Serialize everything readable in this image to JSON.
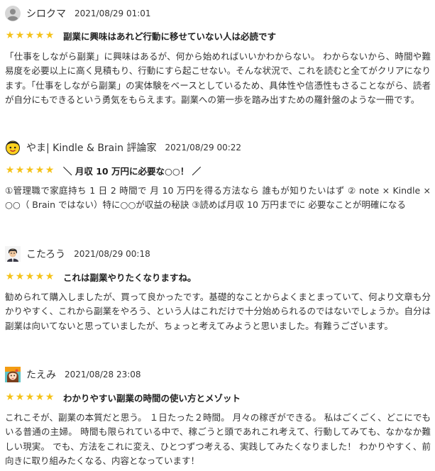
{
  "colors": {
    "star": "#f5c218",
    "text": "#333333"
  },
  "reviews": [
    {
      "name": "シロクマ",
      "date": "2021/08/29 01:01",
      "avatar_icon": "default-user-icon",
      "rating": "★★★★★",
      "stars_value": 5,
      "title": "副業に興味はあれど行動に移せていない人は必読です",
      "body": "「仕事をしながら副業」に興味はあるが、何から始めればいいかわからない。 わからないから、時間や難易度を必要以上に高く見積もり、行動にすら起こせない。そんな状況で、これを読むと全てがクリアになります。「仕事をしながら副業」の実体験をベースとしているため、具体性や信憑性もさることながら、読者が自分にもできるという勇気をもらえます。副業への第一歩を踏み出すための羅針盤のような一冊です。"
    },
    {
      "name": "やま| Kindle & Brain 評論家",
      "date": "2021/08/29 00:22",
      "avatar_icon": "emoji-face-icon",
      "rating": "★★★★★",
      "stars_value": 5,
      "title": "＼ 月収 10 万円に必要な○○！ ／",
      "body": "①管理職で家庭持ち 1 日 2 時間で 月 10 万円を得る方法なら 誰もが知りたいはず ② note × Kindle × ○○（ Brain ではない）特に○○が収益の秘訣 ③読めば月収 10 万円までに 必要なことが明確になる"
    },
    {
      "name": "こたろう",
      "date": "2021/08/29 00:18",
      "avatar_icon": "person-illustration-icon",
      "rating": "★★★★★",
      "stars_value": 5,
      "title": "これは副業やりたくなりますね。",
      "body": "勧められて購入しましたが、買って良かったです。基礎的なことからよくまとまっていて、何より文章も分かりやすく、これから副業をやろう、という人はこれだけで十分始められるのではないでしょうか。自分は副業は向いてないと思っていましたが、ちょっと考えてみようと思いました。有難うございます。"
    },
    {
      "name": "たえみ",
      "date": "2021/08/28 23:08",
      "avatar_icon": "illustrated-girl-icon",
      "rating": "★★★★★",
      "stars_value": 5,
      "title": "わかりやすい副業の時間の使い方とメゾット",
      "body": "これこそが、副業の本質だと思う。 １日たった２時間。 月々の稼ぎができる。 私はごくごく、どこにでもいる普通の主婦。 時間も限られている中で、稼ごうと頭であれこれ考えて、行動してみても、なかなか難しい現実。 でも、方法をこれに変え、ひとつずつ考える、実践してみたくなりました！ わかりやすく、前向きに取り組みたくなる、内容となっています！"
    }
  ]
}
